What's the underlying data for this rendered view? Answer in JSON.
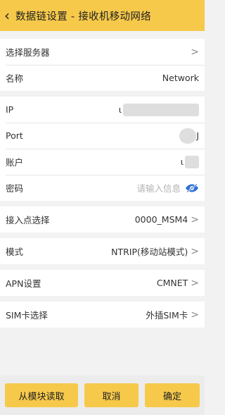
{
  "header": {
    "back_icon": "chevron-left-icon",
    "title": "数据链设置 - 接收机移动网络"
  },
  "server": {
    "label": "选择服务器",
    "chevron": ">"
  },
  "name": {
    "label": "名称",
    "value": "Network"
  },
  "ip": {
    "label": "IP",
    "value": "ι"
  },
  "port": {
    "label": "Port",
    "value": "J"
  },
  "account": {
    "label": "账户",
    "value": "ι"
  },
  "password": {
    "label": "密码",
    "placeholder": "请输入信息",
    "eye_icon": "eye-hidden-icon",
    "accent": "#2f6fd6"
  },
  "mountpoint": {
    "label": "接入点选择",
    "value": "0000_MSM4",
    "chevron": ">"
  },
  "mode": {
    "label": "模式",
    "value": "NTRIP(移动站模式)",
    "chevron": ">"
  },
  "apn": {
    "label": "APN设置",
    "value": "CMNET",
    "chevron": ">"
  },
  "sim": {
    "label": "SIM卡选择",
    "value": "外插SIM卡",
    "chevron": ">"
  },
  "footer": {
    "read_label": "从模块读取",
    "cancel_label": "取消",
    "ok_label": "确定"
  },
  "colors": {
    "accent": "#f6c94a",
    "background": "#f2f2f2"
  }
}
